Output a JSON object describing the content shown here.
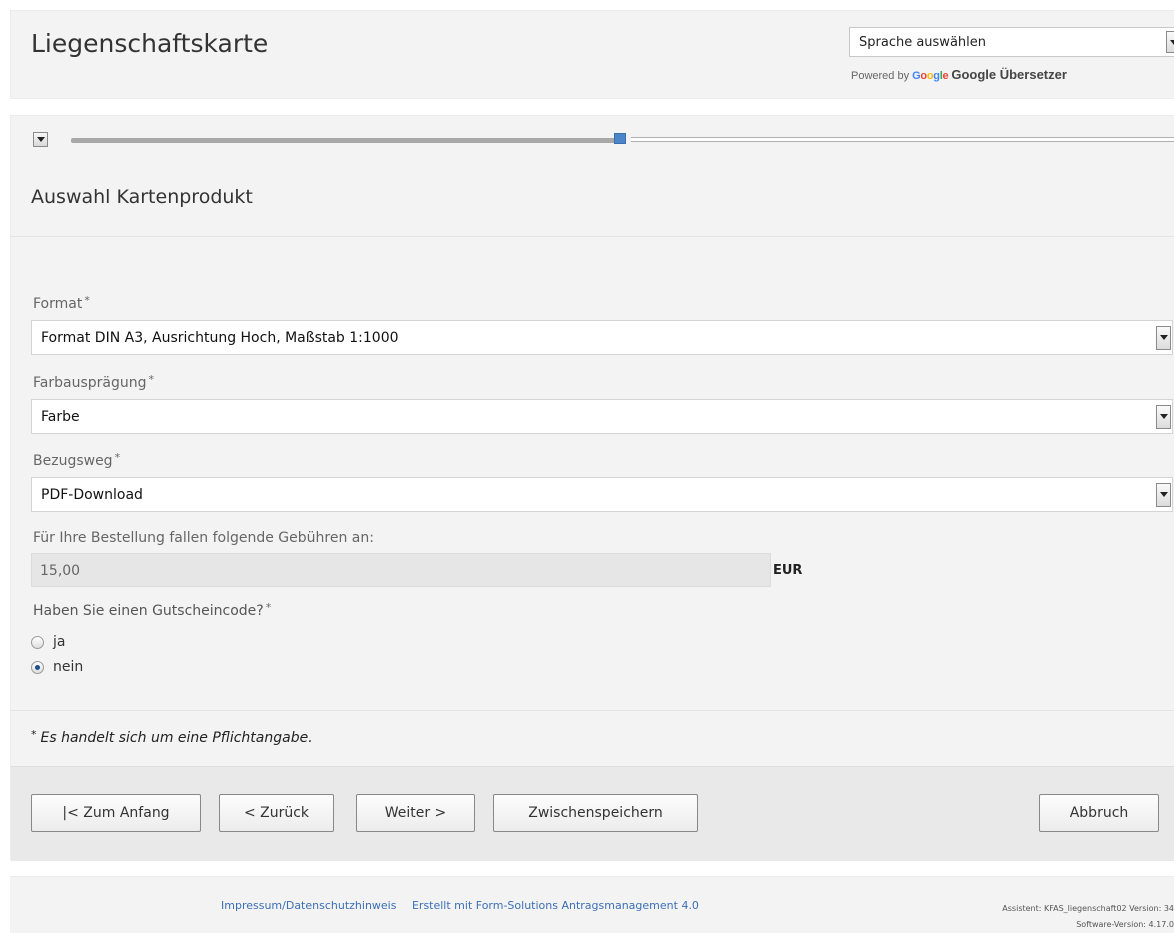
{
  "header": {
    "title": "Liegenschaftskarte",
    "language_select": {
      "value": "Sprache auswählen"
    },
    "powered_by": "Powered by",
    "google_logo": "Google",
    "translator": "Google Übersetzer"
  },
  "wizard": {
    "progress_fraction": 0.53,
    "section_title": "Auswahl Kartenprodukt"
  },
  "form": {
    "format": {
      "label": "Format",
      "required": "*",
      "value": "Format DIN A3, Ausrichtung Hoch, Maßstab 1:1000"
    },
    "color": {
      "label": "Farbausprägung",
      "required": "*",
      "value": "Farbe"
    },
    "delivery": {
      "label": "Bezugsweg",
      "required": "*",
      "value": "PDF-Download"
    },
    "fee": {
      "label": "Für Ihre Bestellung fallen folgende Gebühren an:",
      "value": "15,00",
      "unit": "EUR"
    },
    "voucher": {
      "label": "Haben Sie einen Gutscheincode?",
      "required": "*",
      "options": [
        {
          "label": "ja",
          "checked": false
        },
        {
          "label": "nein",
          "checked": true
        }
      ]
    },
    "footnote": {
      "marker": "*",
      "text": "Es handelt sich um eine Pflichtangabe."
    }
  },
  "buttons": {
    "first": "|< Zum Anfang",
    "back": "< Zurück",
    "next": "Weiter >",
    "save": "Zwischenspeichern",
    "cancel": "Abbruch"
  },
  "footer": {
    "imprint": "Impressum/Datenschutzhinweis",
    "created_with": "Erstellt mit Form-Solutions Antragsmanagement 4.0",
    "assistant": "Assistent: KFAS_liegenschaft02 Version: 34",
    "software": "Software-Version: 4.17.0"
  }
}
